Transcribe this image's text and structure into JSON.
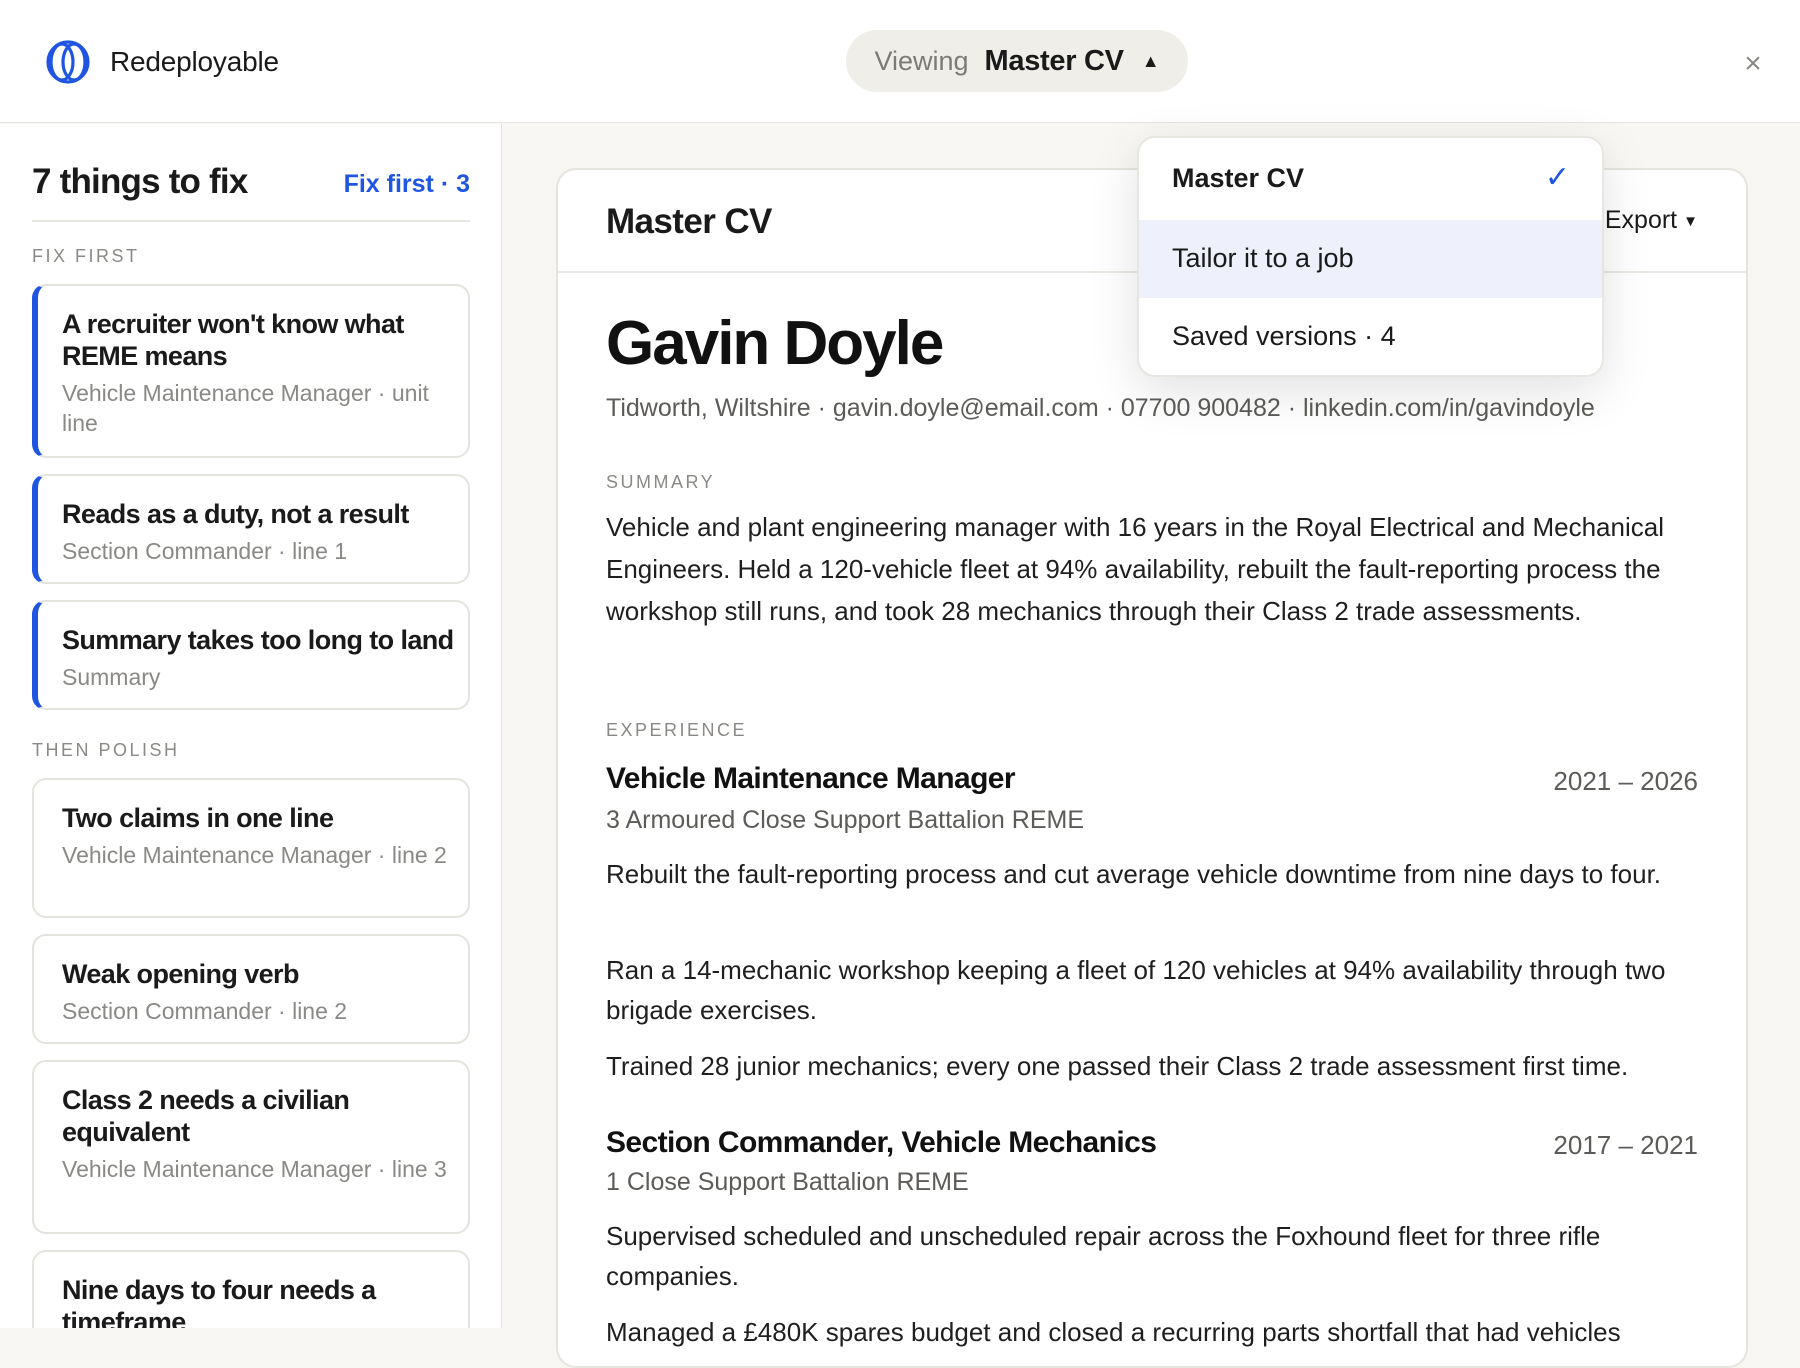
{
  "brand": {
    "name": "Redeployable"
  },
  "header": {
    "viewing_label": "Viewing",
    "viewing_value": "Master CV",
    "close": "×"
  },
  "dropdown": {
    "items": [
      {
        "label": "Master CV",
        "selected": true,
        "check": "✓"
      },
      {
        "label": "Tailor it to a job"
      },
      {
        "label": "Saved versions · 4"
      }
    ]
  },
  "sidebar": {
    "title": "7 things to fix",
    "fix_first_link": "Fix first · 3",
    "fix_first_label": "FIX FIRST",
    "then_polish_label": "THEN POLISH",
    "fix_first": [
      {
        "title": "A recruiter won't know what REME means",
        "sub": "Vehicle Maintenance Manager · unit line"
      },
      {
        "title": "Reads as a duty, not a result",
        "sub": "Section Commander · line 1"
      },
      {
        "title": "Summary takes too long to land",
        "sub": "Summary"
      }
    ],
    "polish": [
      {
        "title": "Two claims in one line",
        "sub": "Vehicle Maintenance Manager · line 2"
      },
      {
        "title": "Weak opening verb",
        "sub": "Section Commander · line 2"
      },
      {
        "title": "Class 2 needs a civilian equivalent",
        "sub": "Vehicle Maintenance Manager · line 3"
      },
      {
        "title": "Nine days to four needs a timeframe",
        "sub": ""
      }
    ]
  },
  "cv": {
    "panel_title": "Master CV",
    "export_label": "Export",
    "name": "Gavin Doyle",
    "contact": "Tidworth, Wiltshire · gavin.doyle@email.com · 07700 900482 · linkedin.com/in/gavindoyle",
    "summary_label": "SUMMARY",
    "summary": "Vehicle and plant engineering manager with 16 years in the Royal Electrical and Mechanical Engineers. Held a 120-vehicle fleet at 94% availability, rebuilt the fault-reporting process the workshop still runs, and took 28 mechanics through their Class 2 trade assessments.",
    "experience_label": "EXPERIENCE",
    "jobs": [
      {
        "title": "Vehicle Maintenance Manager",
        "dates": "2021 – 2026",
        "org": "3 Armoured Close Support Battalion REME",
        "bullets": [
          "Rebuilt the fault-reporting process and cut average vehicle downtime from nine days to four.",
          "Ran a 14-mechanic workshop keeping a fleet of 120 vehicles at 94% availability through two brigade exercises.",
          "Trained 28 junior mechanics; every one passed their Class 2 trade assessment first time."
        ]
      },
      {
        "title": "Section Commander, Vehicle Mechanics",
        "dates": "2017 – 2021",
        "org": "1 Close Support Battalion REME",
        "bullets": [
          "Supervised scheduled and unscheduled repair across the Foxhound fleet for three rifle companies.",
          "Managed a £480K spares budget and closed a recurring parts shortfall that had vehicles"
        ]
      }
    ]
  },
  "colors": {
    "accent": "#1f55e0",
    "dropdown_hover": "#eef1fc",
    "background": "#f8f7f3"
  }
}
